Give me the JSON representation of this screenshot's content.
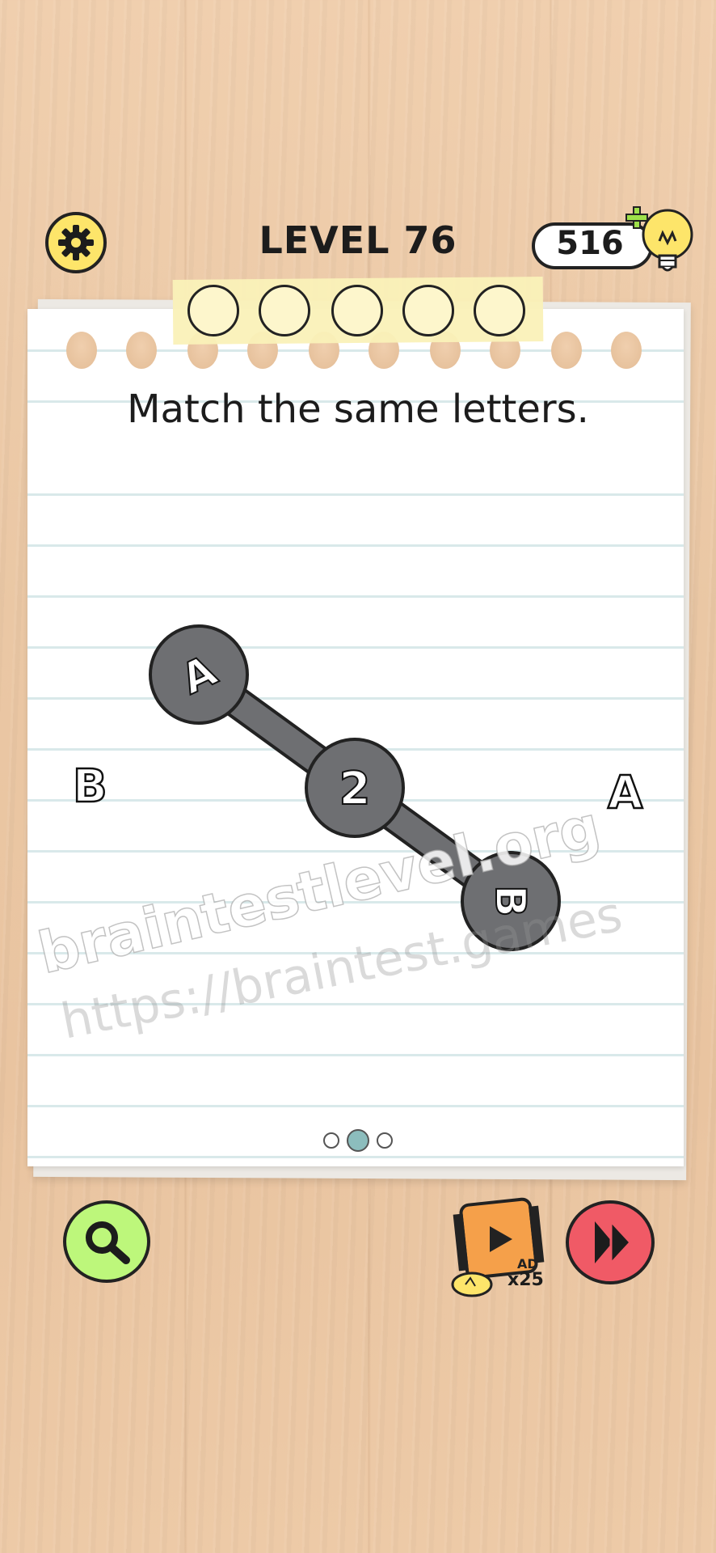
{
  "header": {
    "level_label": "LEVEL 76",
    "bulb_count": "516"
  },
  "progress": {
    "total_stars": 5,
    "filled_stars": 0
  },
  "puzzle": {
    "instruction": "Match the same letters.",
    "nodes": [
      {
        "id": "node-a",
        "label": "A"
      },
      {
        "id": "node-2",
        "label": "2"
      },
      {
        "id": "node-b",
        "label": "B"
      }
    ],
    "left_letter": "B",
    "right_letter": "A"
  },
  "watermarks": {
    "primary": "braintestlevel.org",
    "secondary": "https://braintest.games"
  },
  "pager": {
    "pages": 3,
    "current": 2
  },
  "bottom": {
    "ad_badge": "AD",
    "ad_reward": "x25"
  },
  "colors": {
    "settings": "#fde56a",
    "hint": "#bdf77b",
    "skip": "#f05a66",
    "node": "#6e6f72",
    "ad_orange": "#f5a04a"
  },
  "icons": {
    "settings": "gear-icon",
    "bulb": "lightbulb-icon",
    "hint": "magnifier-icon",
    "skip": "fast-forward-icon",
    "ad": "video-ad-icon"
  }
}
